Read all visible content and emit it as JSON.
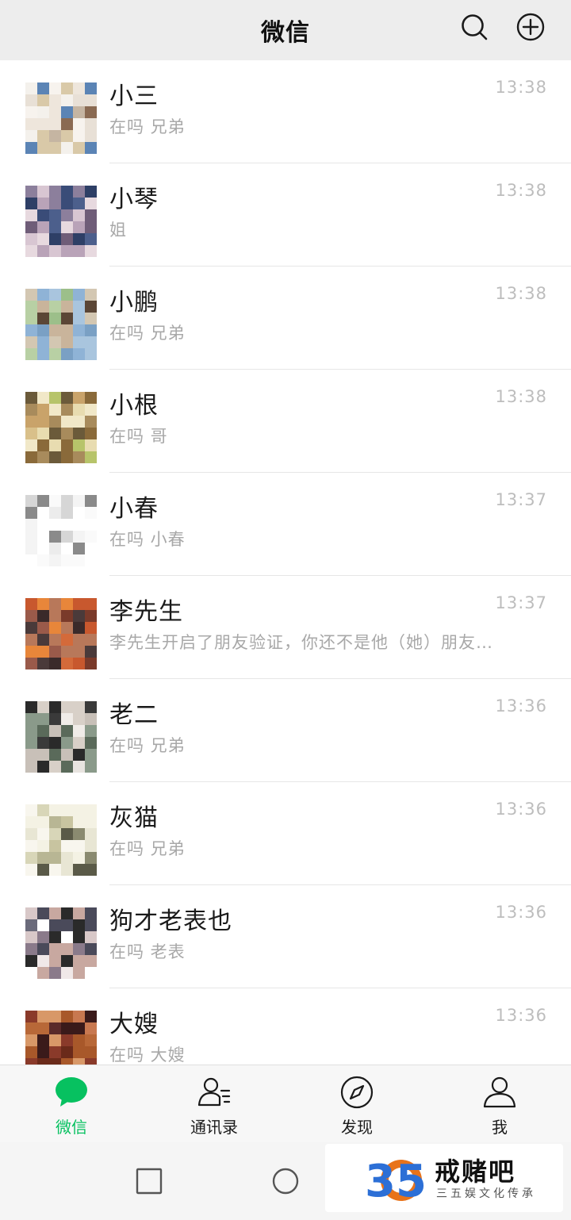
{
  "header": {
    "title": "微信",
    "search_icon": "search-icon",
    "add_icon": "plus-circle-icon"
  },
  "colors": {
    "accent": "#07c160",
    "header_bg": "#ededed",
    "tabbar_bg": "#f7f7f7",
    "subtext": "#a8a8a8",
    "time": "#bdbdbd"
  },
  "chats": [
    {
      "name": "小三",
      "message": "在吗  兄弟",
      "time": "13:38"
    },
    {
      "name": "小琴",
      "message": "姐",
      "time": "13:38"
    },
    {
      "name": "小鹏",
      "message": "在吗 兄弟",
      "time": "13:38"
    },
    {
      "name": "小根",
      "message": "在吗 哥",
      "time": "13:38"
    },
    {
      "name": "小春",
      "message": "在吗 小春",
      "time": "13:37"
    },
    {
      "name": "李先生",
      "message": "李先生开启了朋友验证，你还不是他（她）朋友…",
      "time": "13:37"
    },
    {
      "name": "老二",
      "message": "在吗 兄弟",
      "time": "13:36"
    },
    {
      "name": "灰猫",
      "message": "在吗  兄弟",
      "time": "13:36"
    },
    {
      "name": "狗才老表也",
      "message": "在吗 老表",
      "time": "13:36"
    },
    {
      "name": "大嫂",
      "message": "在吗 大嫂",
      "time": "13:36"
    }
  ],
  "tabs": [
    {
      "label": "微信",
      "icon": "chat-bubble-icon",
      "active": true
    },
    {
      "label": "通讯录",
      "icon": "contacts-icon",
      "active": false
    },
    {
      "label": "发现",
      "icon": "compass-icon",
      "active": false
    },
    {
      "label": "我",
      "icon": "person-icon",
      "active": false
    }
  ],
  "system_nav": {
    "icons": [
      "recent-apps-icon",
      "home-icon"
    ]
  },
  "watermark": {
    "logo_text": "35",
    "title": "戒赌吧",
    "subtitle": "三五娱文化传承"
  }
}
